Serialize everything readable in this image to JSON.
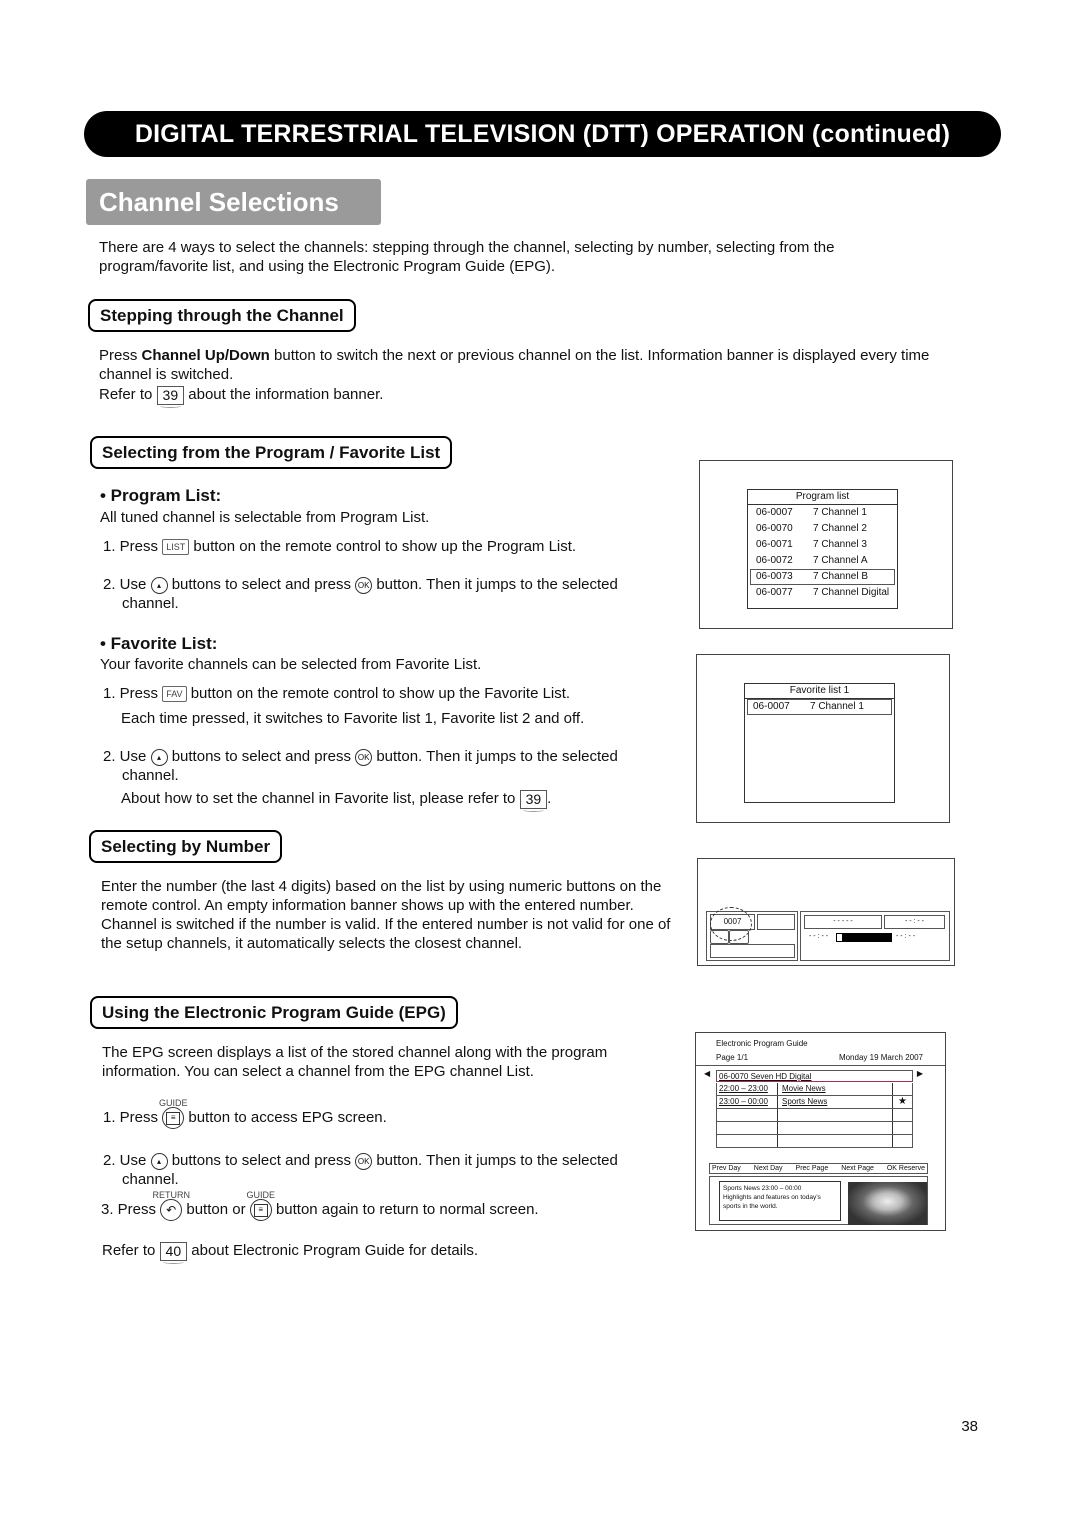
{
  "header": {
    "banner": "DIGITAL TERRESTRIAL TELEVISION (DTT) OPERATION (continued)",
    "section_title": "Channel Selections"
  },
  "intro": "There are 4 ways to select the channels: stepping through the channel, selecting by number, selecting from the program/favorite list, and using the Electronic Program Guide (EPG).",
  "stepping": {
    "title": "Stepping through the Channel",
    "text_pre": "Press ",
    "text_bold": "Channel Up/Down",
    "text_post": " button to switch the next or previous channel on the list. Information banner is displayed every time channel is switched.",
    "refer_pre": "Refer to",
    "refer_page": "39",
    "refer_post": "about the information banner."
  },
  "program_fav": {
    "title": "Selecting from the Program / Favorite List",
    "program": {
      "heading": "• Program List:",
      "desc": "All tuned channel is selectable from Program List.",
      "step1_pre": "1. Press",
      "step1_key": "LIST",
      "step1_post": "button on the remote control to show up the Program List.",
      "step2_pre": "2. Use",
      "step2_mid": "buttons to select and press",
      "step2_post": "button. Then it jumps to the selected",
      "step2_cont": "channel.",
      "ok_label": "OK"
    },
    "favorite": {
      "heading": "• Favorite List:",
      "desc": "Your favorite channels can be selected from Favorite List.",
      "step1_pre": "1. Press",
      "step1_key": "FAV",
      "step1_post": "button on the remote control to show up the Favorite List.",
      "step1_note": "Each time pressed, it switches to Favorite list 1, Favorite list 2 and off.",
      "step2_pre": "2. Use",
      "step2_mid": "buttons to select and press",
      "step2_post": "button. Then it jumps to the selected",
      "step2_cont": "channel.",
      "about_pre": "About how to set the channel in Favorite list, please refer to",
      "about_page": "39",
      "about_post": ".",
      "ok_label": "OK"
    }
  },
  "program_screen": {
    "title": "Program list",
    "rows": [
      {
        "num": "06-0007",
        "name": "7 Channel 1",
        "selected": false
      },
      {
        "num": "06-0070",
        "name": "7 Channel 2",
        "selected": false
      },
      {
        "num": "06-0071",
        "name": "7 Channel 3",
        "selected": false
      },
      {
        "num": "06-0072",
        "name": "7 Channel A",
        "selected": false
      },
      {
        "num": "06-0073",
        "name": "7 Channel B",
        "selected": true
      },
      {
        "num": "06-0077",
        "name": "7 Channel Digital",
        "selected": false
      }
    ]
  },
  "favorite_screen": {
    "title": "Favorite list 1",
    "rows": [
      {
        "num": "06-0007",
        "name": "7 Channel 1",
        "selected": true
      }
    ]
  },
  "by_number": {
    "title": "Selecting by Number",
    "text": "Enter the number (the last 4 digits) based on the list by using numeric buttons on the remote control. An empty information banner shows up with the entered number. Channel is switched if the number is valid. If the entered number is not valid for one of the setup channels, it automatically selects the closest channel."
  },
  "number_screen": {
    "entered": "0007",
    "program_placeholder": "- - - - -",
    "time_placeholder": "- - : - -",
    "start_placeholder": "- - : - -",
    "end_placeholder": "- - : - -",
    "progress": 0.1
  },
  "epg": {
    "title": "Using the Electronic Program Guide (EPG)",
    "text": "The EPG screen displays a list of the stored channel along with the program information. You can select a channel from the EPG channel List.",
    "guide_label": "GUIDE",
    "return_label": "RETURN",
    "step1_pre": "1. Press",
    "step1_post": "button to access EPG screen.",
    "step2_pre": "2. Use",
    "step2_mid": "buttons to select and press",
    "step2_post": "button. Then it jumps to the selected",
    "step2_cont": "channel.",
    "step3_pre": "3. Press",
    "step3_mid": "button or",
    "step3_post": "button again to return to normal screen.",
    "refer_pre": "Refer to",
    "refer_page": "40",
    "refer_post": "about Electronic Program Guide for details.",
    "ok_label": "OK"
  },
  "epg_screen": {
    "title": "Electronic Program Guide",
    "page": "Page 1/1",
    "date": "Monday 19 March 2007",
    "channel": "06-0070 Seven HD Digital",
    "programs": [
      {
        "time": "22:00 – 23:00",
        "name": "Movie News",
        "reserved": false
      },
      {
        "time": "23:00 – 00:00",
        "name": "Sports News",
        "reserved": true
      },
      {
        "time": "",
        "name": "",
        "reserved": false
      },
      {
        "time": "",
        "name": "",
        "reserved": false
      },
      {
        "time": "",
        "name": "",
        "reserved": false
      }
    ],
    "footer": [
      "Prev Day",
      "Next Day",
      "Prec Page",
      "Next Page",
      "OK Reserve"
    ],
    "info_title": "Sports News 23:00 – 00:00",
    "info_text": "Highlights and features on today’s sports in the world."
  },
  "page_number": "38"
}
